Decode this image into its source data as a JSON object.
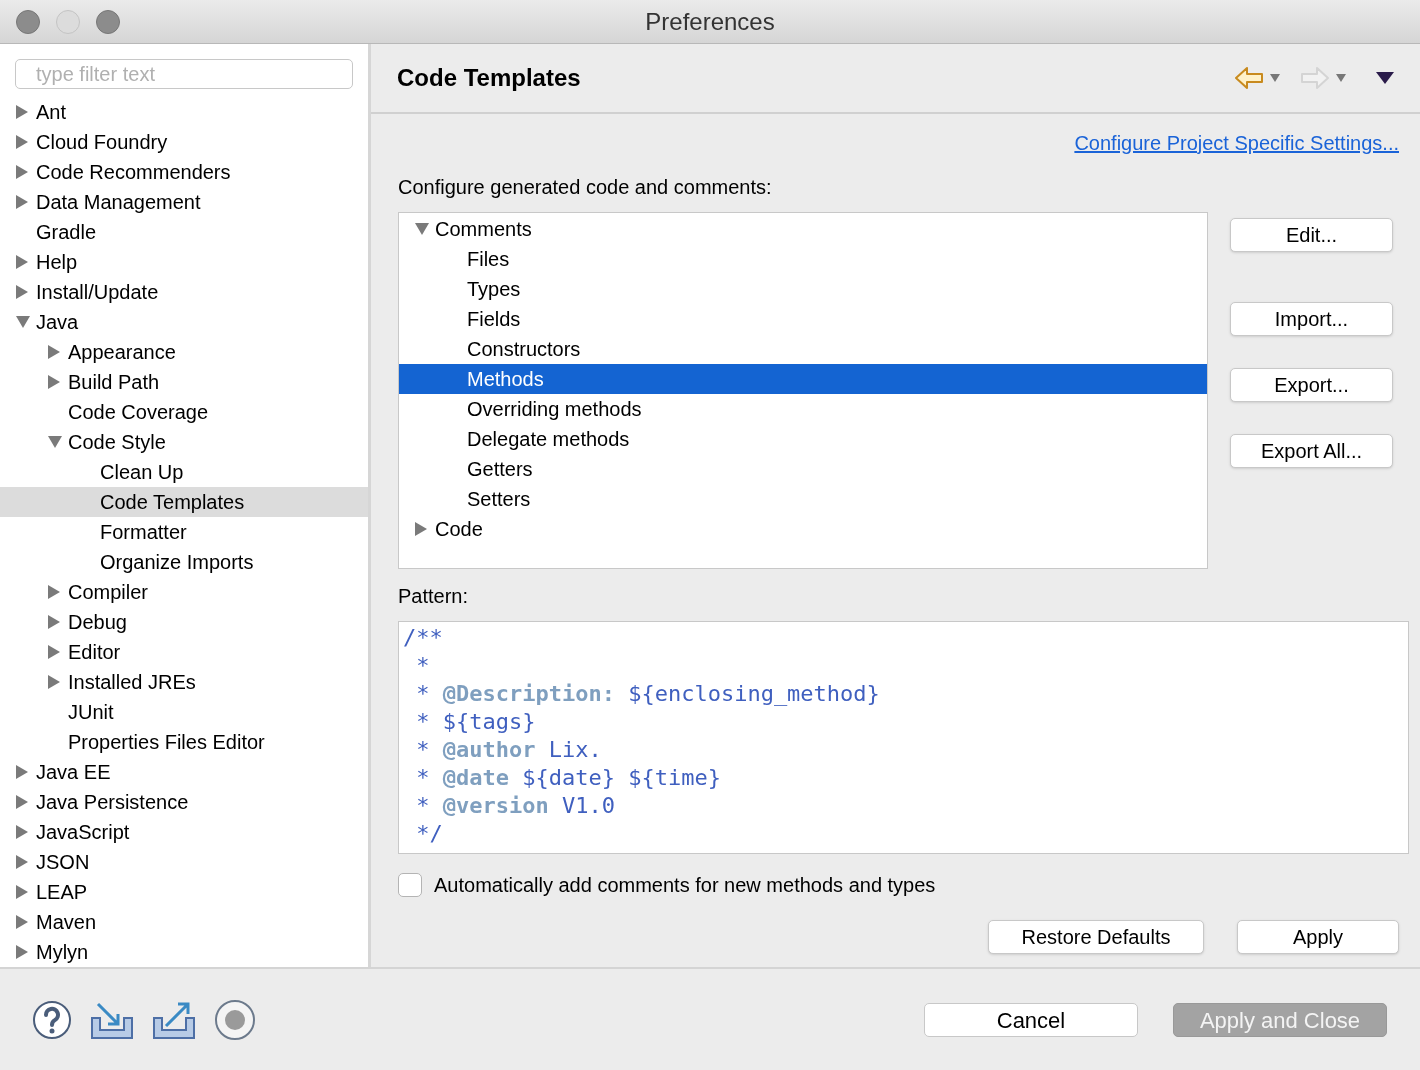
{
  "window": {
    "title": "Preferences"
  },
  "filter": {
    "placeholder": "type filter text"
  },
  "sidebar": {
    "items": [
      {
        "label": "Ant",
        "expanded": false,
        "selected": false
      },
      {
        "label": "Cloud Foundry",
        "expanded": false,
        "selected": false
      },
      {
        "label": "Code Recommenders",
        "expanded": false,
        "selected": false
      },
      {
        "label": "Data Management",
        "expanded": false,
        "selected": false
      },
      {
        "label": "Gradle",
        "selected": false
      },
      {
        "label": "Help",
        "expanded": false,
        "selected": false
      },
      {
        "label": "Install/Update",
        "expanded": false,
        "selected": false
      },
      {
        "label": "Java",
        "expanded": true,
        "selected": false,
        "children": [
          {
            "label": "Appearance",
            "expanded": false,
            "selected": false
          },
          {
            "label": "Build Path",
            "expanded": false,
            "selected": false
          },
          {
            "label": "Code Coverage",
            "selected": false
          },
          {
            "label": "Code Style",
            "expanded": true,
            "selected": false,
            "children": [
              {
                "label": "Clean Up",
                "selected": false
              },
              {
                "label": "Code Templates",
                "selected": true
              },
              {
                "label": "Formatter",
                "selected": false
              },
              {
                "label": "Organize Imports",
                "selected": false
              }
            ]
          },
          {
            "label": "Compiler",
            "expanded": false,
            "selected": false
          },
          {
            "label": "Debug",
            "expanded": false,
            "selected": false
          },
          {
            "label": "Editor",
            "expanded": false,
            "selected": false
          },
          {
            "label": "Installed JREs",
            "expanded": false,
            "selected": false
          },
          {
            "label": "JUnit",
            "selected": false
          },
          {
            "label": "Properties Files Editor",
            "selected": false
          }
        ]
      },
      {
        "label": "Java EE",
        "expanded": false,
        "selected": false
      },
      {
        "label": "Java Persistence",
        "expanded": false,
        "selected": false
      },
      {
        "label": "JavaScript",
        "expanded": false,
        "selected": false
      },
      {
        "label": "JSON",
        "expanded": false,
        "selected": false
      },
      {
        "label": "LEAP",
        "expanded": false,
        "selected": false
      },
      {
        "label": "Maven",
        "expanded": false,
        "selected": false
      },
      {
        "label": "Mylyn",
        "expanded": false,
        "selected": false
      }
    ]
  },
  "page": {
    "title": "Code Templates",
    "link": "Configure Project Specific Settings...",
    "intro": "Configure generated code and comments:",
    "templates": [
      {
        "label": "Comments",
        "expanded": true,
        "selected": false,
        "children": [
          {
            "label": "Files",
            "selected": false
          },
          {
            "label": "Types",
            "selected": false
          },
          {
            "label": "Fields",
            "selected": false
          },
          {
            "label": "Constructors",
            "selected": false
          },
          {
            "label": "Methods",
            "selected": true
          },
          {
            "label": "Overriding methods",
            "selected": false
          },
          {
            "label": "Delegate methods",
            "selected": false
          },
          {
            "label": "Getters",
            "selected": false
          },
          {
            "label": "Setters",
            "selected": false
          }
        ]
      },
      {
        "label": "Code",
        "expanded": false,
        "selected": false
      }
    ],
    "side_buttons": [
      "Edit...",
      "Import...",
      "Export...",
      "Export All..."
    ],
    "pattern_label": "Pattern:",
    "pattern": [
      [
        {
          "kind": "text",
          "text": "/**"
        }
      ],
      [
        {
          "kind": "text",
          "text": " *"
        }
      ],
      [
        {
          "kind": "text",
          "text": " * "
        },
        {
          "kind": "tag",
          "text": "@Description:"
        },
        {
          "kind": "text",
          "text": " ${enclosing_method}"
        }
      ],
      [
        {
          "kind": "text",
          "text": " * ${tags}"
        }
      ],
      [
        {
          "kind": "text",
          "text": " * "
        },
        {
          "kind": "tag",
          "text": "@author"
        },
        {
          "kind": "text",
          "text": " Lix."
        }
      ],
      [
        {
          "kind": "text",
          "text": " * "
        },
        {
          "kind": "tag",
          "text": "@date"
        },
        {
          "kind": "text",
          "text": " ${date} ${time}"
        }
      ],
      [
        {
          "kind": "text",
          "text": " * "
        },
        {
          "kind": "tag",
          "text": "@version"
        },
        {
          "kind": "text",
          "text": " V1.0"
        }
      ],
      [
        {
          "kind": "text",
          "text": " */"
        }
      ]
    ],
    "auto_comments": {
      "label": "Automatically add comments for new methods and types",
      "checked": false
    },
    "buttons": [
      {
        "label": "Restore Defaults"
      },
      {
        "label": "Apply"
      }
    ]
  },
  "footer": {
    "buttons": [
      {
        "label": "Cancel",
        "disabled": false
      },
      {
        "label": "Apply and Close",
        "disabled": true
      }
    ]
  }
}
